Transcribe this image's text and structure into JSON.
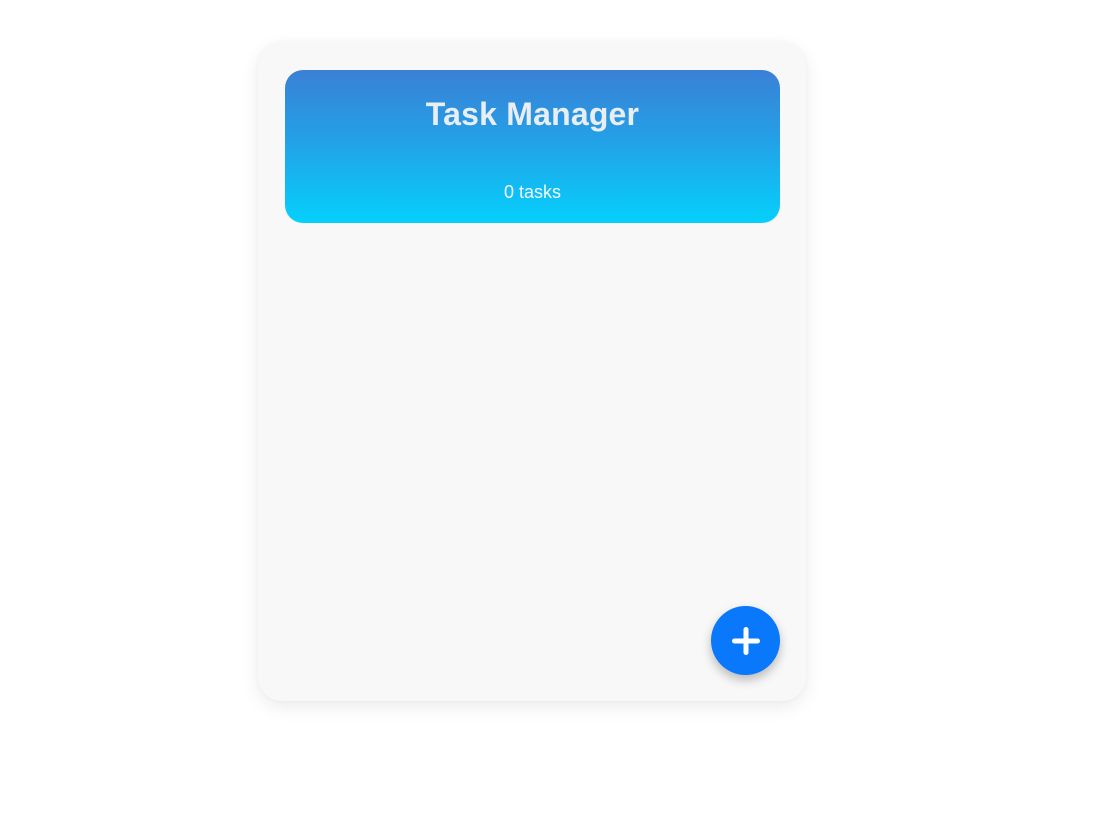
{
  "header": {
    "title": "Task Manager",
    "task_count_text": "0 tasks"
  },
  "tasks": [],
  "fab": {
    "icon": "plus-icon",
    "color": "#0a78fb"
  },
  "colors": {
    "header_gradient_top": "#3a80d6",
    "header_gradient_bottom": "#05d0fc",
    "card_background": "#f8f8f8"
  }
}
